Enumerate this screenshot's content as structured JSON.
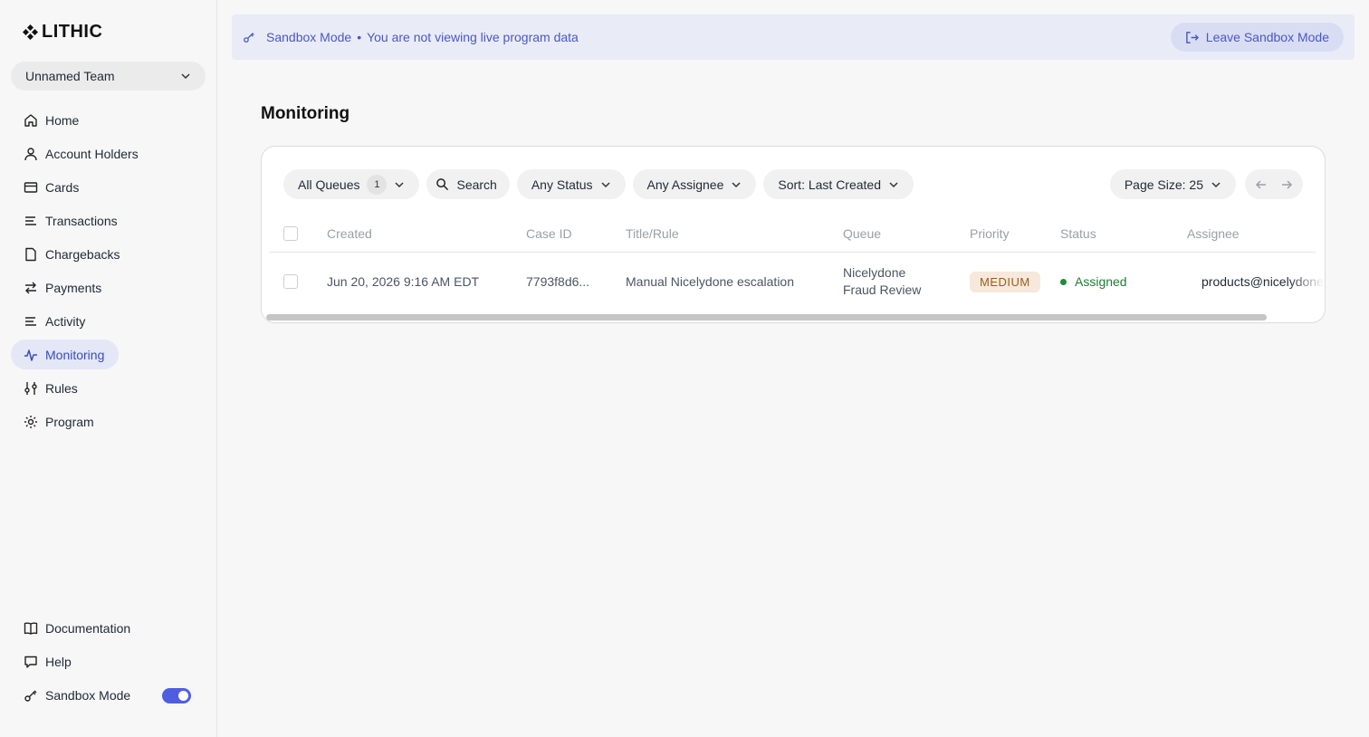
{
  "brand": {
    "name": "LITHIC"
  },
  "team": {
    "name": "Unnamed Team"
  },
  "sidebar": {
    "items": [
      {
        "label": "Home",
        "icon": "home-icon"
      },
      {
        "label": "Account Holders",
        "icon": "user-icon"
      },
      {
        "label": "Cards",
        "icon": "card-icon"
      },
      {
        "label": "Transactions",
        "icon": "list-icon"
      },
      {
        "label": "Chargebacks",
        "icon": "document-icon"
      },
      {
        "label": "Payments",
        "icon": "arrows-icon"
      },
      {
        "label": "Activity",
        "icon": "list-icon"
      },
      {
        "label": "Monitoring",
        "icon": "pulse-icon",
        "active": true
      },
      {
        "label": "Rules",
        "icon": "sliders-icon"
      },
      {
        "label": "Program",
        "icon": "gear-icon"
      }
    ],
    "bottom": [
      {
        "label": "Documentation",
        "icon": "book-icon"
      },
      {
        "label": "Help",
        "icon": "chat-icon"
      },
      {
        "label": "Sandbox Mode",
        "icon": "key-icon",
        "toggle_on": true
      }
    ]
  },
  "banner": {
    "title": "Sandbox Mode",
    "separator": "•",
    "message": "You are not viewing live program data",
    "leave_label": "Leave Sandbox Mode"
  },
  "page": {
    "title": "Monitoring"
  },
  "filters": {
    "queues_label": "All Queues",
    "queues_count": "1",
    "search_label": "Search",
    "status_label": "Any Status",
    "assignee_label": "Any Assignee",
    "sort_label": "Sort: Last Created",
    "page_size_label": "Page Size: 25"
  },
  "table": {
    "headers": [
      "Created",
      "Case ID",
      "Title/Rule",
      "Queue",
      "Priority",
      "Status",
      "Assignee"
    ],
    "rows": [
      {
        "created": "Jun 20, 2026 9:16 AM EDT",
        "case_id": "7793f8d6...",
        "title": "Manual Nicelydone escalation",
        "queue_line1": "Nicelydone",
        "queue_line2": "Fraud Review",
        "priority": "MEDIUM",
        "status": "Assigned",
        "assignee": "products@nicelydone"
      }
    ]
  },
  "colors": {
    "accent": "#4a58c0",
    "active_nav_bg": "#e3e7f6",
    "toggle": "#4f5ee0",
    "status_green": "#1f8a3b",
    "priority_medium_bg": "#f6e9dc"
  }
}
